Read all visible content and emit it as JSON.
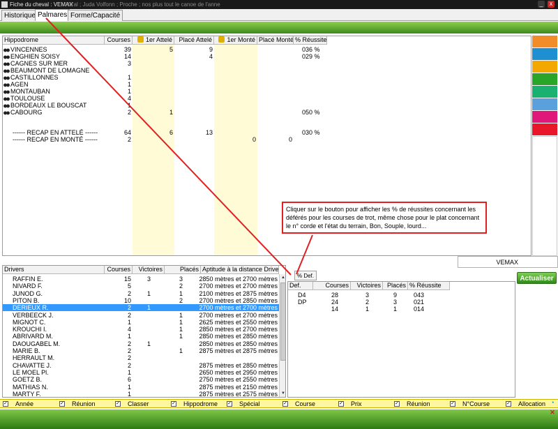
{
  "window": {
    "title": "Fiche du cheval : VEMAX",
    "faded_title": "Yo'al ; Juda Volfonn ; Proche ; nos plus tout le canoe de l'anne",
    "minimize_glyph": "_",
    "close_glyph": "x"
  },
  "tabs": [
    {
      "label": "Historique"
    },
    {
      "label": "Palmares"
    },
    {
      "label": "Forme/Capacité"
    }
  ],
  "palmares": {
    "columns": [
      "Hippodrome",
      "Courses",
      "1er Attelé",
      "Placé Attelé",
      "1er Monté",
      "Placé Monté",
      "% Réussite"
    ],
    "rows": [
      {
        "hippodrome": "VINCENNES",
        "courses": "39",
        "premier_attele": "5",
        "place_attele": "9",
        "premier_monte": "",
        "place_monte": "",
        "reussite": "036 %"
      },
      {
        "hippodrome": "ENGHIEN SOISY",
        "courses": "14",
        "premier_attele": "",
        "place_attele": "4",
        "premier_monte": "",
        "place_monte": "",
        "reussite": "029 %"
      },
      {
        "hippodrome": "CAGNES SUR MER",
        "courses": "3",
        "premier_attele": "",
        "place_attele": "",
        "premier_monte": "",
        "place_monte": "",
        "reussite": ""
      },
      {
        "hippodrome": "BEAUMONT DE LOMAGNE",
        "courses": "",
        "premier_attele": "",
        "place_attele": "",
        "premier_monte": "",
        "place_monte": "",
        "reussite": ""
      },
      {
        "hippodrome": "CASTILLONNES",
        "courses": "1",
        "premier_attele": "",
        "place_attele": "",
        "premier_monte": "",
        "place_monte": "",
        "reussite": ""
      },
      {
        "hippodrome": "AGEN",
        "courses": "1",
        "premier_attele": "",
        "place_attele": "",
        "premier_monte": "",
        "place_monte": "",
        "reussite": ""
      },
      {
        "hippodrome": "MONTAUBAN",
        "courses": "1",
        "premier_attele": "",
        "place_attele": "",
        "premier_monte": "",
        "place_monte": "",
        "reussite": ""
      },
      {
        "hippodrome": "TOULOUSE",
        "courses": "4",
        "premier_attele": "",
        "place_attele": "",
        "premier_monte": "",
        "place_monte": "",
        "reussite": ""
      },
      {
        "hippodrome": "BORDEAUX LE BOUSCAT",
        "courses": "1",
        "premier_attele": "",
        "place_attele": "",
        "premier_monte": "",
        "place_monte": "",
        "reussite": ""
      },
      {
        "hippodrome": "CABOURG",
        "courses": "2",
        "premier_attele": "1",
        "place_attele": "",
        "premier_monte": "",
        "place_monte": "",
        "reussite": "050 %"
      }
    ],
    "recaps": [
      {
        "label": "------ RECAP EN ATTELÉ ------",
        "courses": "64",
        "premier_attele": "6",
        "place_attele": "13",
        "premier_monte": "",
        "place_monte": "",
        "reussite": "030 %"
      },
      {
        "label": "------ RECAP EN MONTÉ ------",
        "courses": "2",
        "premier_attele": "",
        "place_attele": "",
        "premier_monte": "0",
        "place_monte": "0",
        "reussite": ""
      }
    ]
  },
  "swatches": [
    "#f28c28",
    "#1e8fd0",
    "#f2a800",
    "#2aa52a",
    "#1ab070",
    "#5aa0dc",
    "#e0187a",
    "#e8182a"
  ],
  "drivers": {
    "columns": [
      "Drivers",
      "Courses",
      "Victoires",
      "Placés",
      "Aptitude à la distance Drivers"
    ],
    "selected_index": 4,
    "rows": [
      {
        "name": "RAFFIN E.",
        "courses": "15",
        "victoires": "3",
        "places": "3",
        "aptitude": "2850 mètres et 2700 mètres"
      },
      {
        "name": "NIVARD F.",
        "courses": "5",
        "victoires": "",
        "places": "2",
        "aptitude": "2700 mètres et 2700 mètres"
      },
      {
        "name": "JUNOD G.",
        "courses": "2",
        "victoires": "1",
        "places": "1",
        "aptitude": "2100 mètres et 2875 mètres"
      },
      {
        "name": "PITON B.",
        "courses": "10",
        "victoires": "",
        "places": "2",
        "aptitude": "2700 mètres et 2850 mètres"
      },
      {
        "name": "DERIEUX R.",
        "courses": "2",
        "victoires": "1",
        "places": "",
        "aptitude": "2700 mètres et 2700 mètres"
      },
      {
        "name": "VERBEECK J.",
        "courses": "2",
        "victoires": "",
        "places": "1",
        "aptitude": "2700 mètres et 2700 mètres"
      },
      {
        "name": "MIGNOT C.",
        "courses": "1",
        "victoires": "",
        "places": "1",
        "aptitude": "2625 mètres et 2550 mètres"
      },
      {
        "name": "KROUCHI I.",
        "courses": "4",
        "victoires": "",
        "places": "1",
        "aptitude": "2850 mètres et 2700 mètres"
      },
      {
        "name": "ABRIVARD M.",
        "courses": "1",
        "victoires": "",
        "places": "1",
        "aptitude": "2850 mètres et 2850 mètres"
      },
      {
        "name": "DAOUGABEL M.",
        "courses": "2",
        "victoires": "1",
        "places": "",
        "aptitude": "2850 mètres et 2850 mètres"
      },
      {
        "name": "MARIE B.",
        "courses": "2",
        "victoires": "",
        "places": "1",
        "aptitude": "2875 mètres et 2875 mètres"
      },
      {
        "name": "HERRAULT M.",
        "courses": "2",
        "victoires": "",
        "places": "",
        "aptitude": ""
      },
      {
        "name": "CHAVATTE J.",
        "courses": "2",
        "victoires": "",
        "places": "",
        "aptitude": "2875 mètres et 2850 mètres"
      },
      {
        "name": "LE MOEL Pl.",
        "courses": "1",
        "victoires": "",
        "places": "",
        "aptitude": "2650 mètres et 2950 mètres"
      },
      {
        "name": "GOETZ B.",
        "courses": "6",
        "victoires": "",
        "places": "",
        "aptitude": "2750 mètres et 2550 mètres"
      },
      {
        "name": "MATHIAS N.",
        "courses": "1",
        "victoires": "",
        "places": "",
        "aptitude": "2875 mètres et 2150 mètres"
      },
      {
        "name": "MARTY F.",
        "courses": "1",
        "victoires": "",
        "places": "",
        "aptitude": "2875 mètres et 2575 mètres"
      }
    ]
  },
  "vemax_tab": "VEMAX",
  "actualiser": "Actualiser",
  "pdef_button": "% Def.",
  "deferes": {
    "columns": [
      "Def.",
      "Courses",
      "Victoires",
      "Placés",
      "% Réussite"
    ],
    "rows": [
      {
        "def": "D4",
        "courses": "28",
        "victoires": "3",
        "places": "9",
        "reussite": "043"
      },
      {
        "def": "DP",
        "courses": "24",
        "victoires": "2",
        "places": "3",
        "reussite": "021"
      },
      {
        "def": "",
        "courses": "14",
        "victoires": "1",
        "places": "1",
        "reussite": "014"
      }
    ]
  },
  "callout": "Cliquer sur le bouton pour afficher les % de réussites concernant les déférés pour les courses de trot, même chose pour le plat concernant le n° corde et l'état du terrain, Bon, Souple, lourd...",
  "bottom_filters": [
    "Année",
    "Réunion",
    "Classer",
    "Hippodrome",
    "Spécial",
    "Course",
    "Prix",
    "Réunion",
    "N°Course",
    "Allocation"
  ],
  "colors": {
    "accent_green": "#3d8a1e",
    "selection": "#3399ff",
    "highlight_yellow": "#fffbd7",
    "annotation_red": "#e02020",
    "filter_bar": "#fff7a0"
  }
}
